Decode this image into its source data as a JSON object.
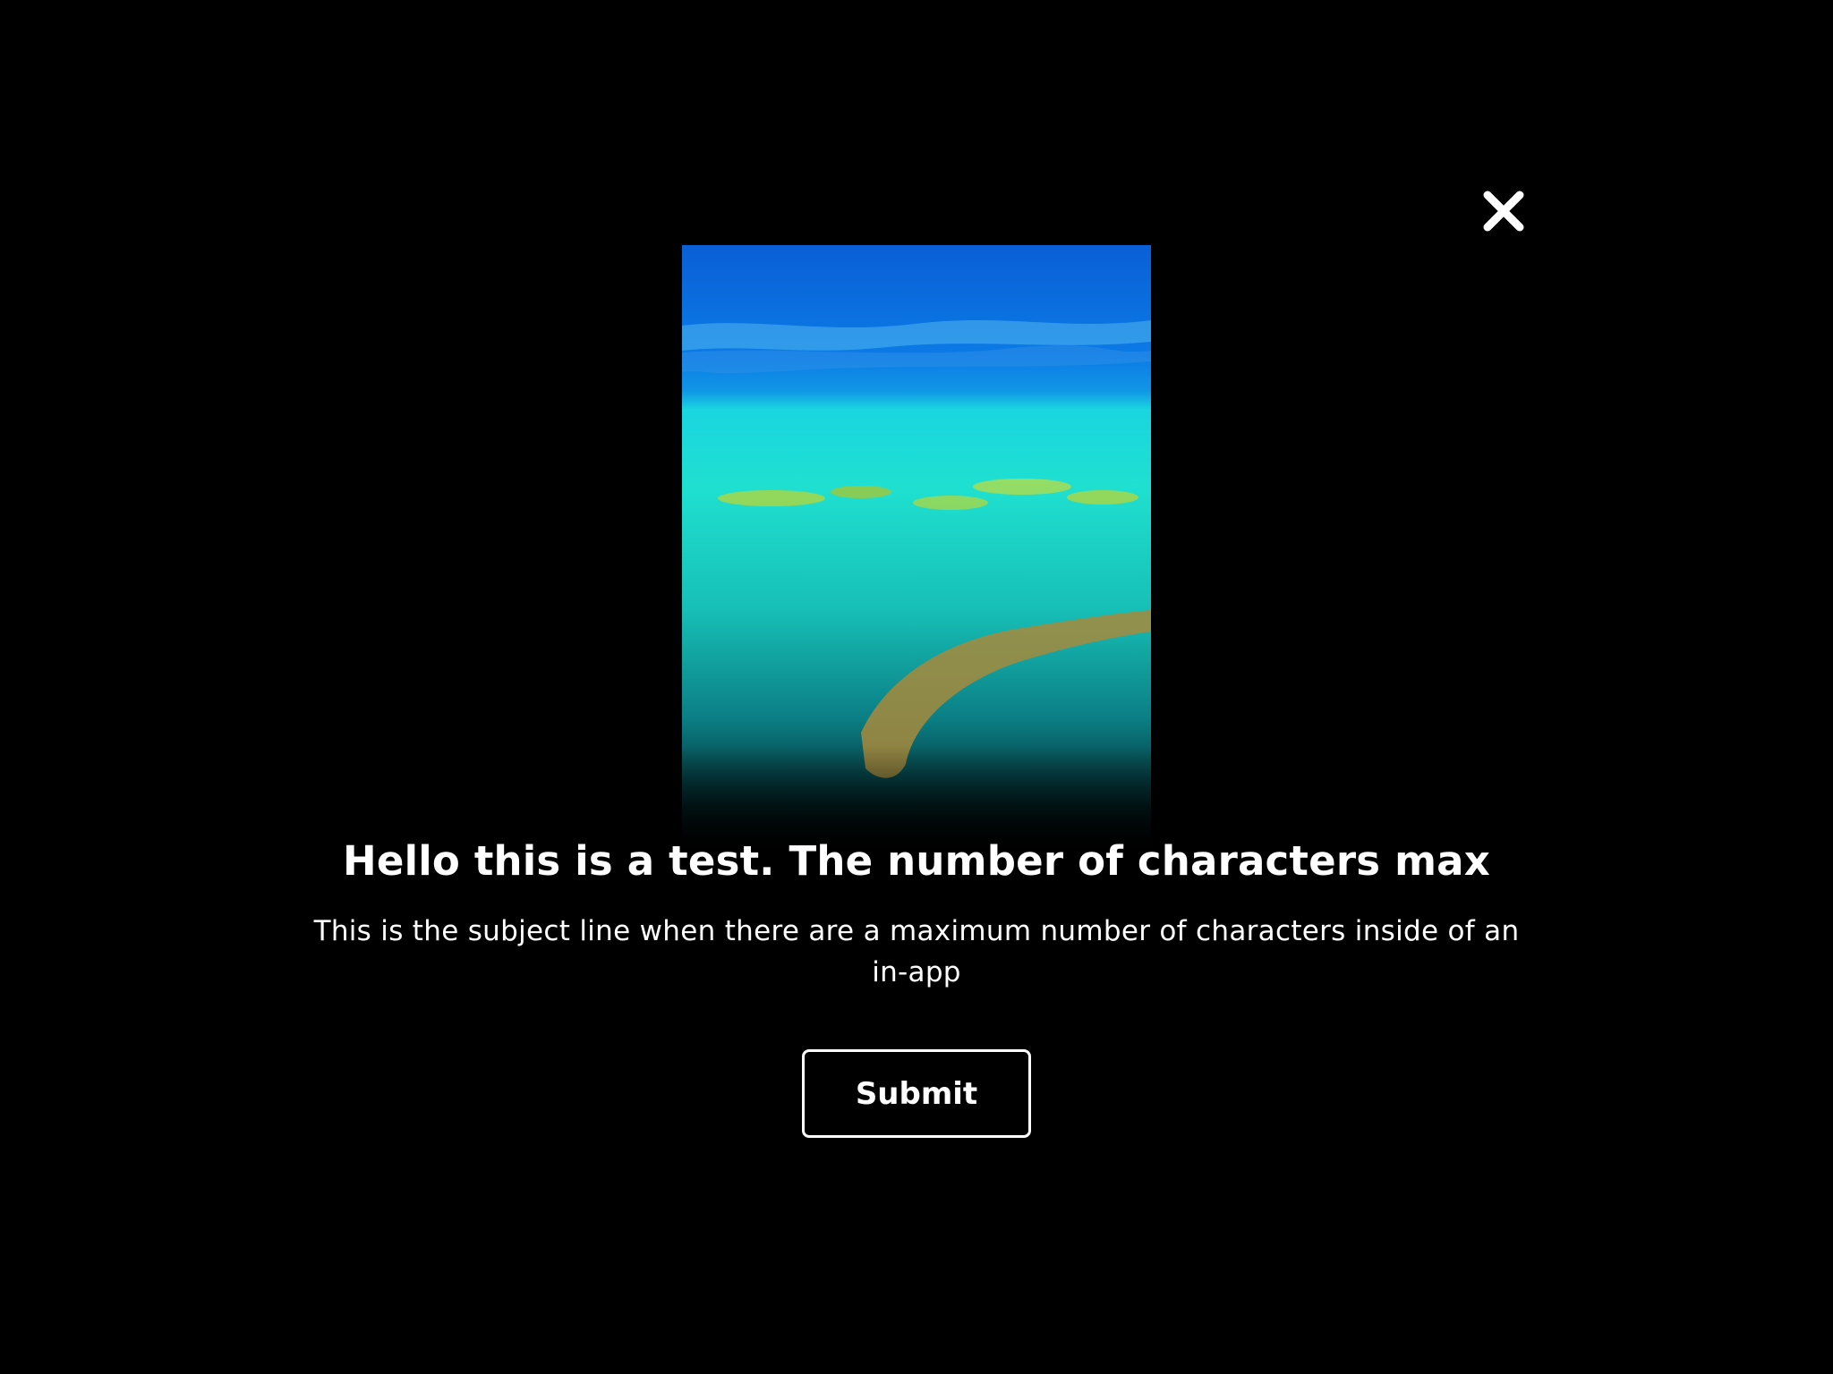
{
  "modal": {
    "image": {
      "description_icon": "reef-aerial-image"
    },
    "title": "Hello this is a test. The number of characters max",
    "subtitle": "This is the subject line when there are a maximum number of characters inside of an in-app",
    "submit_label": "Submit",
    "close_icon": "close-icon"
  },
  "colors": {
    "background": "#000000",
    "text": "#ffffff",
    "deep_water": "#0a5fd6",
    "shallow_water": "#1fe0d0",
    "reef": "#b9d636",
    "sand": "#a78a3c"
  }
}
